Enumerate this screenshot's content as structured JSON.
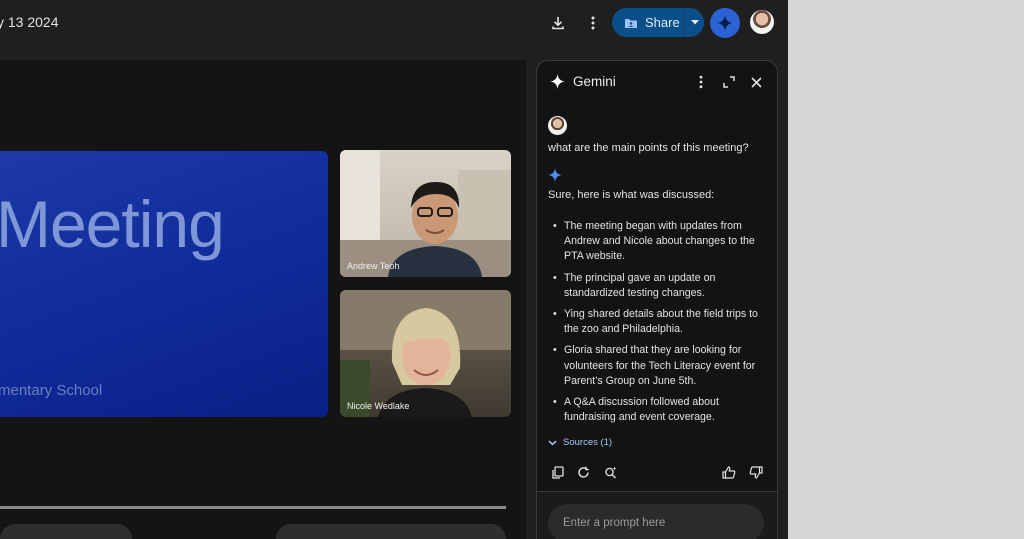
{
  "header": {
    "date_text": "y 13 2024",
    "share_label": "Share"
  },
  "stage": {
    "slide_title": "Meeting",
    "slide_subtitle": "mentary School",
    "participants": [
      {
        "name": "Andrew Teoh"
      },
      {
        "name": "Nicole Wedlake"
      }
    ]
  },
  "gemini": {
    "title": "Gemini",
    "user_question": "what are the main points of this meeting?",
    "answer_intro": "Sure, here is what was discussed:",
    "points": [
      "The meeting began with updates from Andrew and Nicole about changes to the PTA website.",
      "The principal gave an update on standardized testing changes.",
      "Ying shared details about the field trips to the zoo and Philadelphia.",
      "Gloria shared that they are looking for volunteers for the Tech Literacy event for Parent’s Group on June 5th.",
      "A Q&A discussion followed about fundraising and event coverage."
    ],
    "sources_label": "Sources (1)",
    "prompt_placeholder": "Enter a prompt here"
  },
  "colors": {
    "accent_blue": "#2b63d4",
    "share_bg": "#0b4f8a",
    "link_blue": "#a9c7fa",
    "panel_bg": "#131314"
  }
}
